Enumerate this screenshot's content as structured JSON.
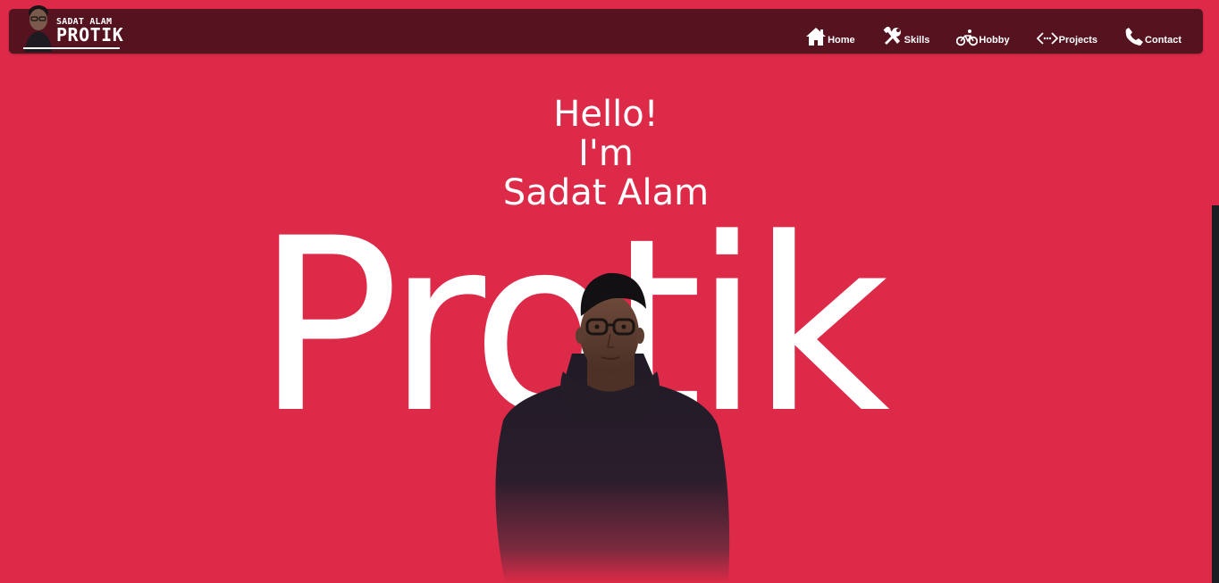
{
  "brand": {
    "line1": "SADAT ALAM",
    "line2": "PROTIK",
    "avatar_icon": "portrait-avatar-icon"
  },
  "nav": {
    "items": [
      {
        "label": "Home",
        "icon": "home-icon"
      },
      {
        "label": "Skills",
        "icon": "tools-icon"
      },
      {
        "label": "Hobby",
        "icon": "bicycle-icon"
      },
      {
        "label": "Projects",
        "icon": "code-arrows-icon"
      },
      {
        "label": "Contact",
        "icon": "phone-icon"
      }
    ]
  },
  "hero": {
    "greeting": "Hello!",
    "intro": "I'm",
    "first_name": "Sadat Alam",
    "big_name": "Protik"
  },
  "colors": {
    "background": "#dd2a48",
    "navbar": "#55121f",
    "text": "#ffffff"
  }
}
